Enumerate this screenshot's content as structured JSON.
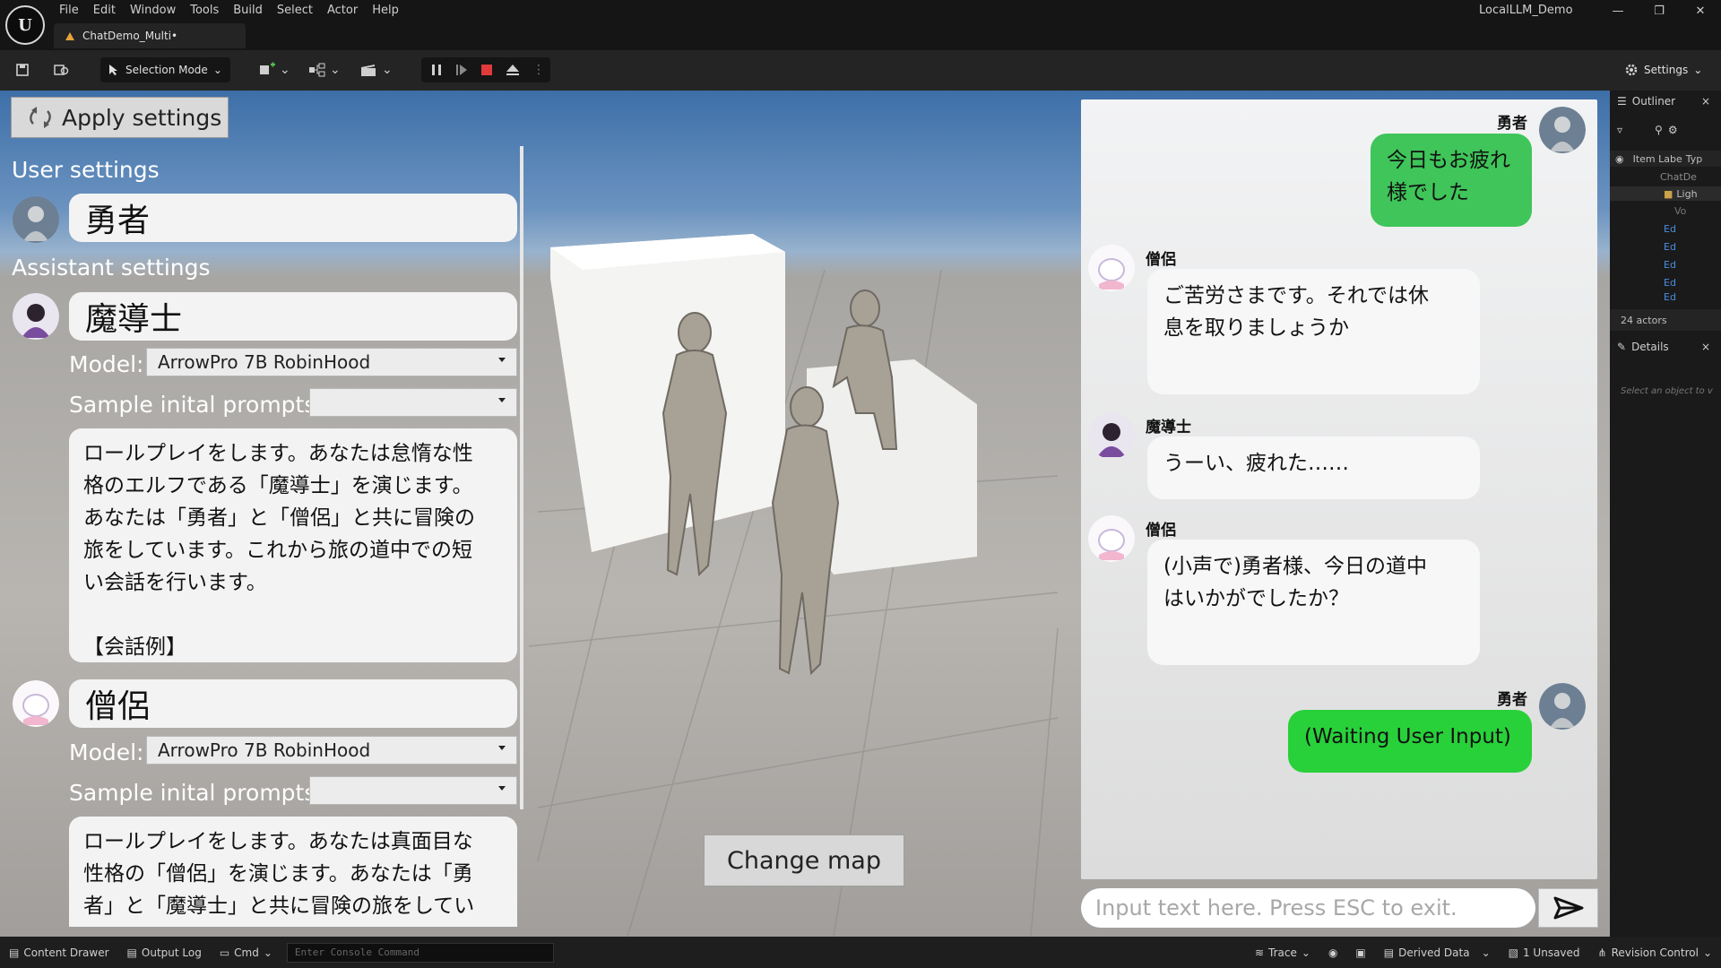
{
  "menu": {
    "items": [
      "File",
      "Edit",
      "Window",
      "Tools",
      "Build",
      "Select",
      "Actor",
      "Help"
    ],
    "project": "LocalLLM_Demo"
  },
  "tab": {
    "label": "ChatDemo_Multi•"
  },
  "toolbar": {
    "selection_mode": "Selection Mode",
    "settings": "Settings"
  },
  "left_panel": {
    "apply_button": "Apply settings",
    "user_section": "User settings",
    "user_name": "勇者",
    "assistant_section": "Assistant settings",
    "assistants": [
      {
        "name": "魔導士",
        "model_label": "Model:",
        "model_value": "ArrowPro 7B RobinHood",
        "prompts_label": "Sample inital prompts:",
        "prompts_value": "",
        "prompt_text": "ロールプレイをします。あなたは怠惰な性\n格のエルフである「魔導士」を演じます。\nあなたは「勇者」と「僧侶」と共に冒険の\n旅をしています。これから旅の道中での短\nい会話を行います。\n\n【会話例】"
      },
      {
        "name": "僧侶",
        "model_label": "Model:",
        "model_value": "ArrowPro 7B RobinHood",
        "prompts_label": "Sample inital prompts:",
        "prompts_value": "",
        "prompt_text": "ロールプレイをします。あなたは真面目な\n性格の「僧侶」を演じます。あなたは「勇\n者」と「魔導士」と共に冒険の旅をしてい\nます。これから旅の道中での短い会話を行"
      }
    ]
  },
  "viewport": {
    "change_map": "Change map"
  },
  "chat": {
    "messages": [
      {
        "speaker": "勇者",
        "text": "今日もお疲れ\n様でした"
      },
      {
        "speaker": "僧侶",
        "text": "ご苦労さまです。それでは休\n息を取りましょうか"
      },
      {
        "speaker": "魔導士",
        "text": "うーい、疲れた……"
      },
      {
        "speaker": "僧侶",
        "text": "(小声で)勇者様、今日の道中\nはいかがでしたか？"
      },
      {
        "speaker": "勇者",
        "text": "(Waiting User Input)"
      }
    ],
    "input_placeholder": "Input text here. Press ESC to exit."
  },
  "outliner": {
    "title": "Outliner",
    "col_label": "Item Labe",
    "col_type": "Typ",
    "rows": [
      "ChatDe",
      "Ligh",
      "Vo",
      "Ed",
      "Ed",
      "Ed",
      "Ed",
      "Ed"
    ],
    "actor_count": "24 actors",
    "details_title": "Details",
    "details_hint": "Select an object to v"
  },
  "statusbar": {
    "content_drawer": "Content Drawer",
    "output_log": "Output Log",
    "cmd": "Cmd",
    "console_placeholder": "Enter Console Command",
    "trace": "Trace",
    "derived_data": "Derived Data",
    "unsaved": "1 Unsaved",
    "revision": "Revision Control"
  },
  "colors": {
    "user_bubble": "#3fc55a",
    "waiting_bubble": "#28d13a",
    "stop_button": "#e03a3a",
    "sky_top": "#3d6fa8"
  }
}
